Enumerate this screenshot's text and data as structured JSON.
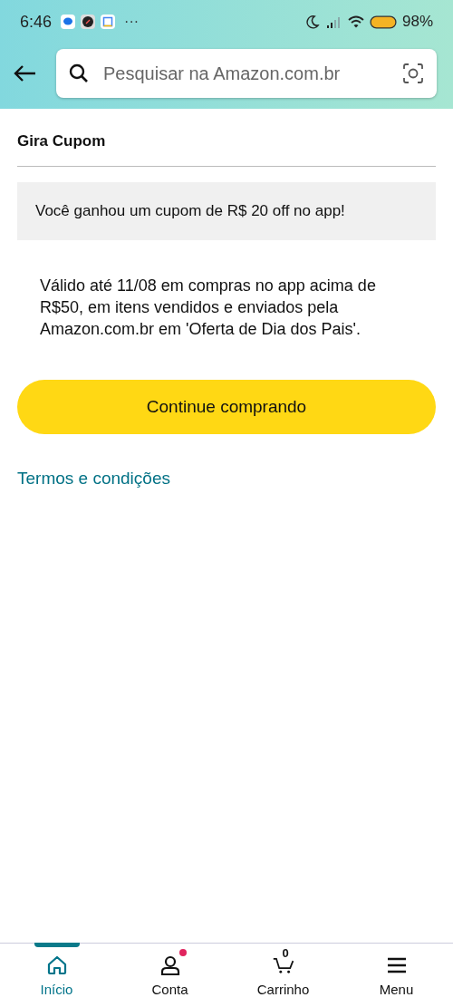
{
  "status_bar": {
    "time": "6:46",
    "more": "···",
    "battery_level_text": "98%"
  },
  "search": {
    "placeholder": "Pesquisar na Amazon.com.br"
  },
  "page": {
    "title": "Gira Cupom",
    "banner": "Você ganhou um cupom de R$ 20 off no app!",
    "description": "Válido até 11/08 em compras no app acima de R$50, em itens vendidos e enviados pela Amazon.com.br em 'Oferta de Dia dos Pais'.",
    "button": "Continue comprando",
    "link": "Termos e condições"
  },
  "nav": [
    {
      "kind": "home",
      "label": "Início",
      "selected": true,
      "badge": false
    },
    {
      "kind": "account",
      "label": "Conta",
      "selected": false,
      "badge": true
    },
    {
      "kind": "cart",
      "label": "Carrinho",
      "selected": false,
      "badge": false,
      "count": "0"
    },
    {
      "kind": "menu",
      "label": "Menu",
      "selected": false,
      "badge": false
    }
  ]
}
